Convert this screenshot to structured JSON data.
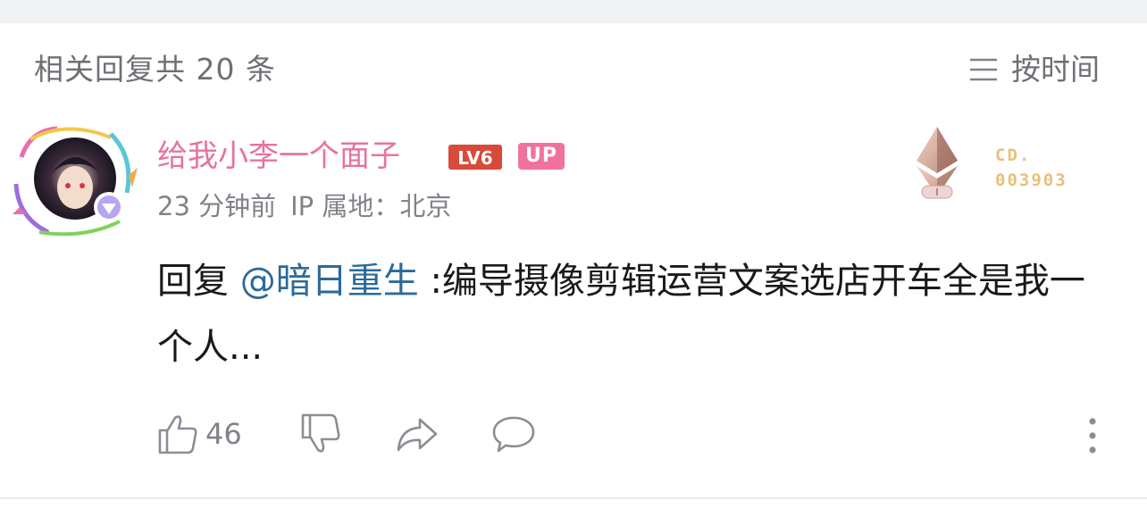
{
  "header": {
    "reply_count_text": "相关回复共 20 条",
    "sort_label": "按时间"
  },
  "comment": {
    "username": "给我小李一个面子",
    "level_badge": "LV6",
    "up_badge": "UP",
    "time": "23 分钟前",
    "ip_location": "IP 属地：北京",
    "card_number": {
      "prefix": "CD.",
      "number": "003903"
    },
    "content": {
      "reply_prefix": "回复",
      "mention": "@暗日重生",
      "text": ":编导摄像剪辑运营文案选店开车全是我一个人..."
    },
    "actions": {
      "like_count": "46"
    }
  },
  "colors": {
    "username": "#e6739f",
    "level_badge": "#d84a3a",
    "up_badge": "#f1739b",
    "mention": "#2b6a9a",
    "meta_text": "#7f8389",
    "card_number": "#e8c07a"
  }
}
